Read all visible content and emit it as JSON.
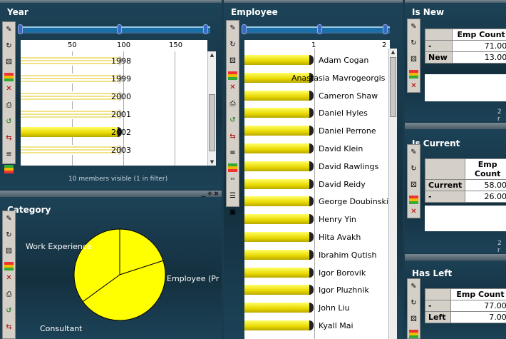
{
  "panels": {
    "year": {
      "title": "Year",
      "axis_ticks": [
        "50",
        "100",
        "150"
      ],
      "rows": [
        {
          "label": "1998",
          "filled": false
        },
        {
          "label": "1999",
          "filled": false
        },
        {
          "label": "2000",
          "filled": false
        },
        {
          "label": "2001",
          "filled": false
        },
        {
          "label": "2002",
          "filled": true
        },
        {
          "label": "2003",
          "filled": false
        }
      ],
      "status": "10 members visible (1 in filter)"
    },
    "category": {
      "title": "Category",
      "slice_labels": [
        "Work Experience",
        "Employee (Pr",
        "Consultant"
      ]
    },
    "employee": {
      "title": "Employee",
      "axis_ticks": [
        "1",
        "2"
      ],
      "names": [
        "Adam Cogan",
        "Anastasia Mavrogeorgis",
        "Cameron Shaw",
        "Daniel Hyles",
        "Daniel Perrone",
        "David Klein",
        "David Rawlings",
        "David Reidy",
        "George Doubinski",
        "Henry Yin",
        "Hita Avakh",
        "Ibrahim Qutish",
        "Igor Borovik",
        "Igor Pluzhnik",
        "John Liu",
        "Kyall Mai"
      ]
    },
    "is_new": {
      "title": "Is New",
      "col_header": "Emp Count",
      "col_header2": "Em",
      "rows": [
        {
          "label": "-",
          "value": "71.00"
        },
        {
          "label": "New",
          "value": "13.00"
        }
      ],
      "status": "2 r"
    },
    "is_current": {
      "title": "Is Current",
      "col_header": "Emp Count",
      "rows": [
        {
          "label": "Current",
          "value": "58.00"
        },
        {
          "label": "-",
          "value": "26.00"
        }
      ],
      "status": "2 r"
    },
    "has_left": {
      "title": "Has Left",
      "col_header": "Emp Count",
      "col_header2": "Em",
      "rows": [
        {
          "label": "-",
          "value": "77.00"
        },
        {
          "label": "Left",
          "value": "7.00"
        }
      ]
    }
  },
  "chart_data": [
    {
      "type": "bar",
      "categories": [
        "1998",
        "1999",
        "2000",
        "2001",
        "2002",
        "2003"
      ],
      "values": [
        85,
        85,
        85,
        85,
        85,
        85
      ],
      "title": "Year",
      "xlim": [
        0,
        190
      ]
    },
    {
      "type": "pie",
      "categories": [
        "Work Experience",
        "Employee (Pr",
        "Consultant"
      ],
      "values": [
        20,
        45,
        35
      ],
      "title": "Category"
    },
    {
      "type": "bar",
      "categories": [
        "Adam Cogan",
        "Anastasia Mavrogeorgis",
        "Cameron Shaw",
        "Daniel Hyles",
        "Daniel Perrone",
        "David Klein",
        "David Rawlings",
        "David Reidy",
        "George Doubinski",
        "Henry Yin",
        "Hita Avakh",
        "Ibrahim Qutish",
        "Igor Borovik",
        "Igor Pluzhnik",
        "John Liu",
        "Kyall Mai"
      ],
      "values": [
        1,
        1,
        1,
        1,
        1,
        1,
        1,
        1,
        1,
        1,
        1,
        1,
        1,
        1,
        1,
        1
      ],
      "title": "Employee",
      "xlim": [
        0,
        2
      ]
    }
  ]
}
